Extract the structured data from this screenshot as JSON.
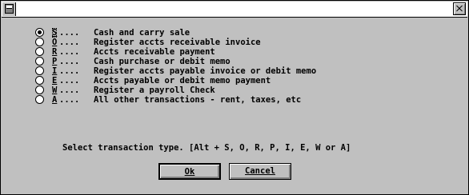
{
  "dialog": {
    "options": [
      {
        "key": "S",
        "dots": "....",
        "label": "Cash and carry sale",
        "selected": true
      },
      {
        "key": "O",
        "dots": "....",
        "label": "Register accts receivable invoice",
        "selected": false
      },
      {
        "key": "R",
        "dots": "....",
        "label": "Accts receivable payment",
        "selected": false
      },
      {
        "key": "P",
        "dots": "....",
        "label": "Cash purchase or debit memo",
        "selected": false
      },
      {
        "key": "I",
        "dots": "....",
        "label": "Register accts payable invoice or debit memo",
        "selected": false
      },
      {
        "key": "E",
        "dots": "....",
        "label": "Accts payable or debit memo payment",
        "selected": false
      },
      {
        "key": "W",
        "dots": "....",
        "label": "Register a payroll Check",
        "selected": false
      },
      {
        "key": "A",
        "dots": "....",
        "label": "All other transactions - rent, taxes, etc",
        "selected": false
      }
    ],
    "prompt": "Select transaction type. [Alt + S, O, R, P, I, E, W or A]",
    "ok_label": "Ok",
    "cancel_label": "Cancel"
  }
}
